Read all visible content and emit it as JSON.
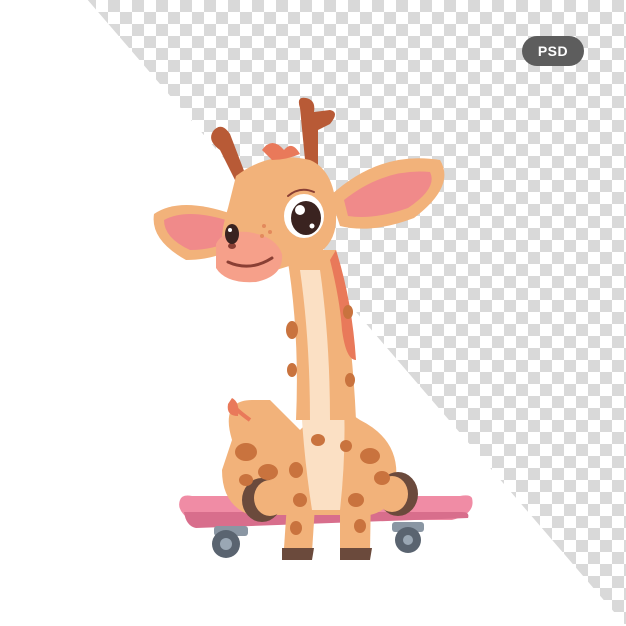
{
  "badge": {
    "label": "PSD",
    "color": "#5d5d5d"
  },
  "background": {
    "pattern": "transparency-checkerboard",
    "colors": [
      "#ffffff",
      "#d9d9d9"
    ]
  },
  "illustration": {
    "subject": "giraffe-on-skateboard",
    "palette": {
      "body": "#f2b27a",
      "spots": "#c9733e",
      "belly": "#fbe0c4",
      "ear_inner": "#f08a8a",
      "skateboard": "#f08ca5",
      "wheels": "#5a6470",
      "mane": "#e9795a"
    }
  }
}
